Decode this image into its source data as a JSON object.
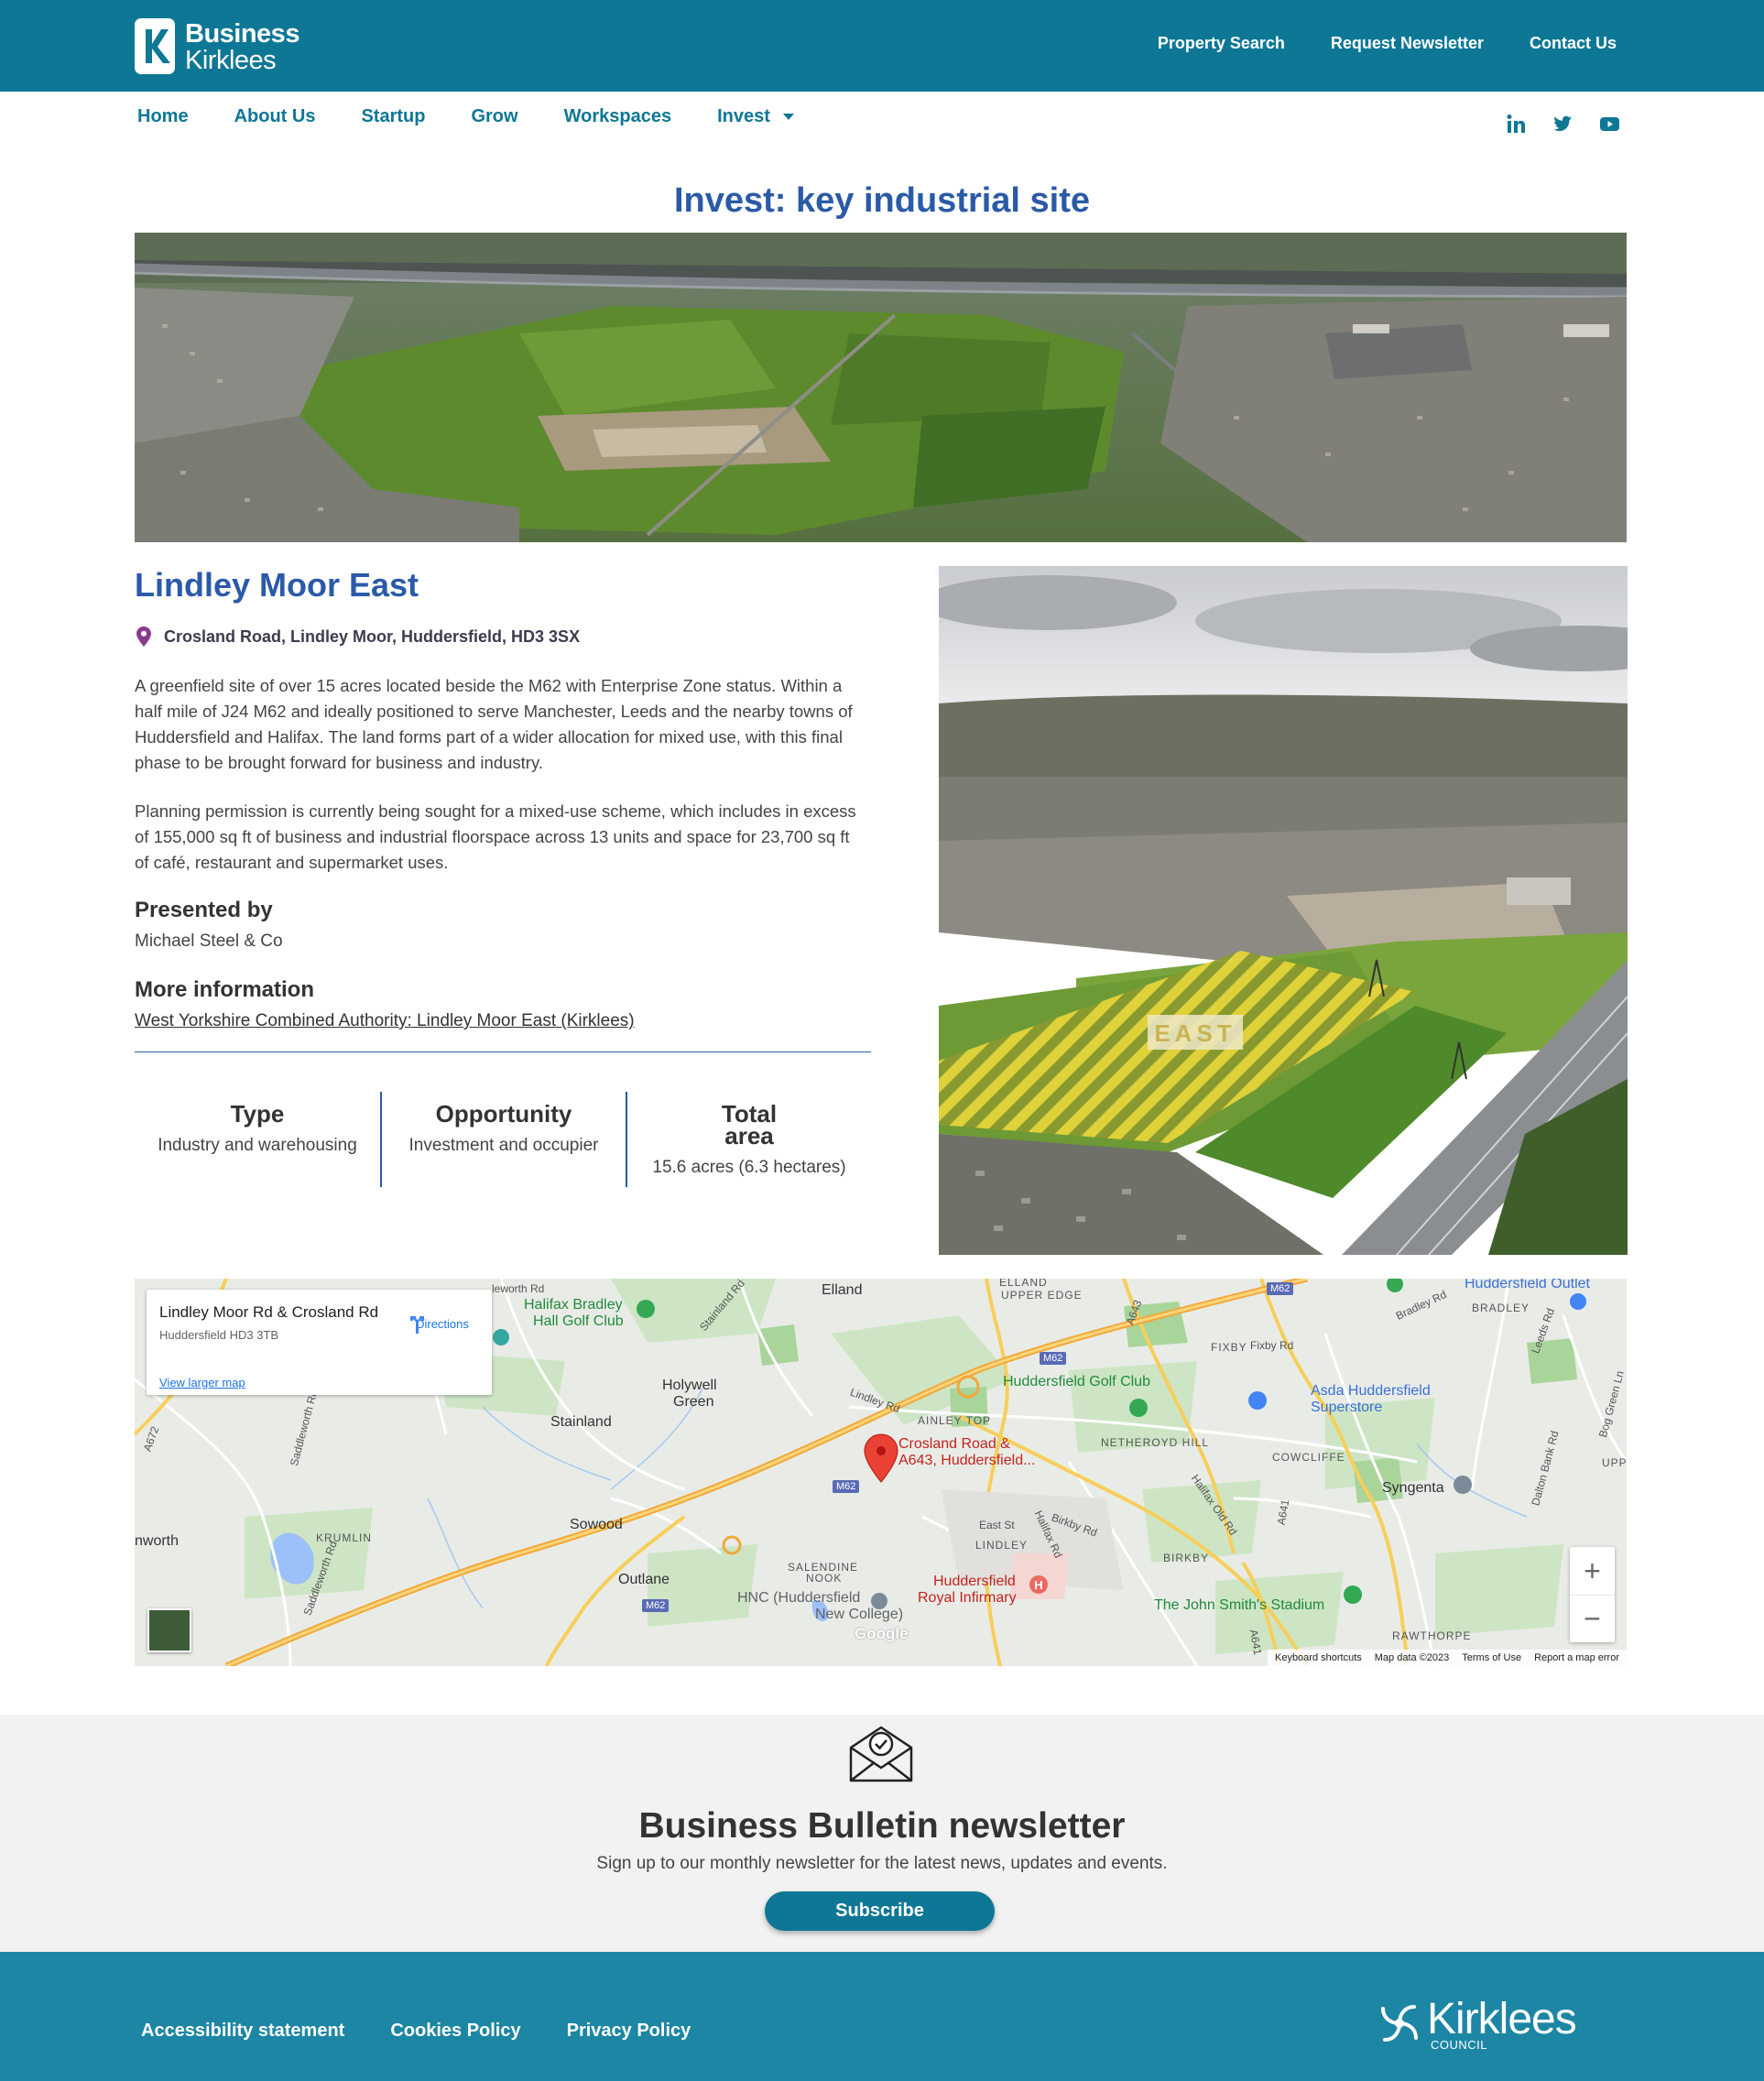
{
  "header": {
    "logo_line1": "Business",
    "logo_line2": "Kirklees",
    "links": [
      "Property Search",
      "Request Newsletter",
      "Contact Us"
    ]
  },
  "nav": {
    "items": [
      "Home",
      "About Us",
      "Startup",
      "Grow",
      "Workspaces",
      "Invest"
    ],
    "social": [
      "linkedin-icon",
      "twitter-icon",
      "youtube-icon"
    ]
  },
  "page": {
    "title": "Invest: key industrial site"
  },
  "site": {
    "name": "Lindley Moor East",
    "address": "Crosland Road, Lindley Moor, Huddersfield, HD3 3SX",
    "paragraph1": "A greenfield site of over 15 acres located beside the M62 with Enterprise Zone status. Within a half mile of J24 M62 and ideally positioned to serve Manchester, Leeds and the nearby towns of Huddersfield and Halifax. The land forms part of a wider allocation for mixed use, with this final phase to be brought forward for business and industry.",
    "paragraph2": "Planning permission is currently being sought for a mixed-use scheme, which includes in excess of 155,000 sq ft of business and industrial floorspace across 13 units and space for 23,700 sq ft of café, restaurant and supermarket uses.",
    "presented_heading": "Presented by",
    "presented_value": "Michael Steel & Co",
    "more_heading": "More information",
    "more_link": "West Yorkshire Combined Authority: Lindley Moor East (Kirklees)",
    "stats": [
      {
        "label": "Type",
        "value": "Industry and warehousing"
      },
      {
        "label": "Opportunity",
        "value": "Investment and occupier"
      },
      {
        "label": "Total area",
        "value": "15.6 acres (6.3 hectares)"
      }
    ],
    "photo_overlay_label": "EAST"
  },
  "map": {
    "card_title": "Lindley Moor Rd & Crosland Rd",
    "card_subtitle": "Huddersfield HD3 3TB",
    "card_link": "View larger map",
    "directions": "Directions",
    "marker_label_line1": "Crosland Road &",
    "marker_label_line2": "A643, Huddersfield...",
    "places": {
      "elland": "Elland",
      "elland_upper": "ELLAND",
      "elland_upper2": "UPPER EDGE",
      "halifax_golf1": "Halifax Bradley",
      "halifax_golf2": "Hall Golf Club",
      "hudds_outlet": "Huddersfield Outlet",
      "bradley": "BRADLEY",
      "fixby": "FIXBY",
      "hudds_golf": "Huddersfield Golf Club",
      "asda1": "Asda Huddersfield",
      "asda2": "Superstore",
      "holywell1": "Holywell",
      "holywell2": "Green",
      "stainland": "Stainland",
      "ainley": "AINLEY TOP",
      "netheroyd": "NETHEROYD HILL",
      "cowcliffe": "COWCLIFFE",
      "syngenta": "Syngenta",
      "sowood": "Sowood",
      "krumlin": "KRUMLIN",
      "worth": "nworth",
      "outlane": "Outlane",
      "salendine1": "SALENDINE",
      "salendine2": "NOOK",
      "lindley": "LINDLEY",
      "birkby": "BIRKBY",
      "upper": "UPPER",
      "hnc1": "HNC (Huddersfield",
      "hnc2": "New College)",
      "infirmary1": "Huddersfield",
      "infirmary2": "Royal Infirmary",
      "stadium": "The John Smith's Stadium",
      "rawthorpe": "RAWTHORPE",
      "m62": "M62",
      "a643": "A643",
      "a641": "A641",
      "a672": "A672"
    },
    "roads": {
      "lindley_moor": "Lindley Rd",
      "saddleworth": "Saddleworth Rd",
      "stainland_rd": "Stainland Rd",
      "halifax_rd": "Halifax Rd",
      "halifax_old": "Halifax Old Rd",
      "birkby_rd": "Birkby Rd",
      "east_st": "East St",
      "fixby_rd": "Fixby Rd",
      "bradley_rd": "Bradley Rd",
      "leeds_rd": "Leeds Rd",
      "dalton": "Dalton Bank Rd",
      "bog_green": "Bog Green Ln",
      "warley": "leworth Rd"
    },
    "google": "Google",
    "footer": [
      "Keyboard shortcuts",
      "Map data ©2023",
      "Terms of Use",
      "Report a map error"
    ],
    "zoom_in": "+",
    "zoom_out": "−"
  },
  "newsletter": {
    "title": "Business Bulletin newsletter",
    "text": "Sign up to our monthly newsletter for the latest news, updates and events.",
    "button": "Subscribe"
  },
  "footer": {
    "links": [
      "Accessibility statement",
      "Cookies Policy",
      "Privacy Policy"
    ],
    "council_word": "Kirklees",
    "council_sub": "COUNCIL"
  },
  "colors": {
    "brand_teal": "#0e7796",
    "heading_blue": "#2a5aa8",
    "footer_teal": "#1c86a4"
  }
}
